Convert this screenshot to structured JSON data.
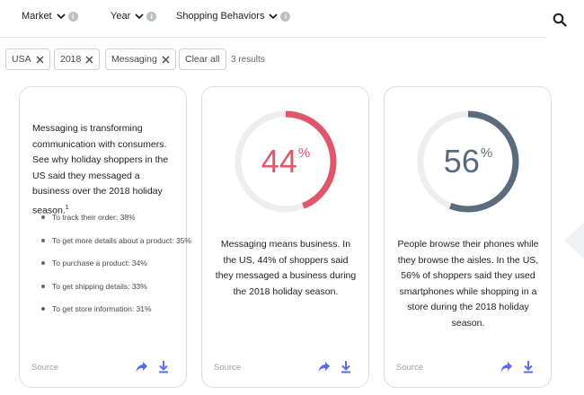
{
  "filters": [
    {
      "label": "Market"
    },
    {
      "label": "Year"
    },
    {
      "label": "Shopping Behaviors"
    }
  ],
  "chips": [
    "USA",
    "2018",
    "Messaging"
  ],
  "clear_all": "Clear all",
  "results": "3 results",
  "card1": {
    "text": "Messaging is transforming communication with consumers. See why holiday shoppers in the US said they messaged a business over the 2018 holiday season.",
    "footnote": "1",
    "bullets": [
      "To track their order: 38%",
      "To get more details about a product: 35%",
      "To purchase a product: 34%",
      "To get shipping details: 33%",
      "To get store information: 31%"
    ],
    "source": "Source"
  },
  "card2": {
    "value": "44",
    "unit": "%",
    "fraction": 0.44,
    "color": "#e0566a",
    "text": "Messaging means business. In the US, 44% of shoppers said they messaged a business during the 2018 holiday season.",
    "source": "Source"
  },
  "card3": {
    "value": "56",
    "unit": "%",
    "fraction": 0.56,
    "color": "#5a6b7b",
    "text": "People browse their phones while they browse the aisles. In the US, 56% of shoppers said they used smartphones while shopping in a store during the 2018 holiday season.",
    "source": "Source"
  },
  "colors": {
    "accent": "#5b6cf0",
    "ring_track": "#eeeeee"
  },
  "icons": {
    "search": "search-icon",
    "share": "share-icon",
    "download": "download-icon",
    "close": "close-icon",
    "info": "info-icon",
    "chevron": "chevron-down-icon"
  }
}
